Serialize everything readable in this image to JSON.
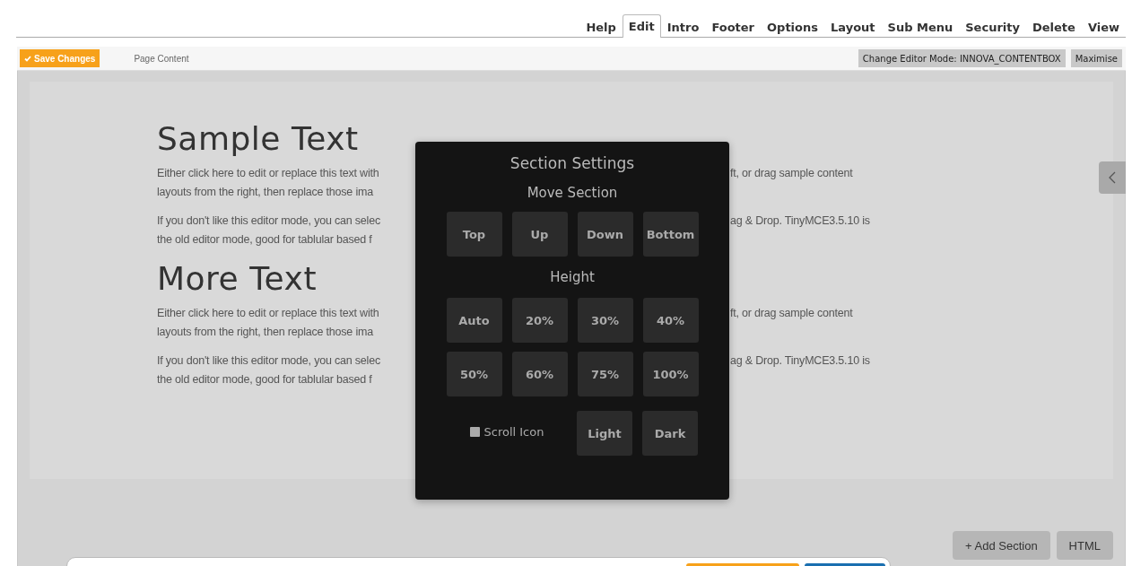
{
  "tabs": [
    {
      "label": "Help",
      "selected": false
    },
    {
      "label": "Edit",
      "selected": true
    },
    {
      "label": "Intro",
      "selected": false
    },
    {
      "label": "Footer",
      "selected": false
    },
    {
      "label": "Options",
      "selected": false
    },
    {
      "label": "Layout",
      "selected": false
    },
    {
      "label": "Sub Menu",
      "selected": false
    },
    {
      "label": "Security",
      "selected": false
    },
    {
      "label": "Delete",
      "selected": false
    },
    {
      "label": "View",
      "selected": false
    }
  ],
  "toolbar": {
    "save_button": "Save Changes",
    "title": "Page Content",
    "mode_button": "Change Editor Mode: INNOVA_CONTENTBOX",
    "maximise_button": "Maximise"
  },
  "content": [
    {
      "kind": "heading",
      "text": "Sample Text"
    },
    {
      "kind": "paragraph",
      "lines": [
        {
          "left": "Either click here to edit or replace this text with",
          "right": "ft, or drag sample content"
        },
        {
          "left": "layouts from the right, then replace those ima"
        }
      ]
    },
    {
      "kind": "paragraph",
      "lines": [
        {
          "left": "If you don't like this editor mode, you can selec",
          "right": "ag & Drop. TinyMCE3.5.10 is"
        },
        {
          "left": "the old editor mode, good for tablular based f"
        }
      ]
    },
    {
      "kind": "heading",
      "text": "More Text"
    },
    {
      "kind": "paragraph",
      "lines": [
        {
          "left": "Either click here to edit or replace this text with",
          "right": "ft, or drag sample content"
        },
        {
          "left": "layouts from the right, then replace those ima"
        }
      ]
    },
    {
      "kind": "paragraph",
      "lines": [
        {
          "left": "If you don't like this editor mode, you can selec",
          "right": "ag & Drop. TinyMCE3.5.10 is"
        },
        {
          "left": "the old editor mode, good for tablular based f"
        }
      ]
    }
  ],
  "section_settings": {
    "title": "Section Settings",
    "move_heading": "Move Section",
    "move_buttons": [
      "Top",
      "Up",
      "Down",
      "Bottom"
    ],
    "height_heading": "Height",
    "height_buttons": [
      "Auto",
      "20%",
      "30%",
      "40%",
      "50%",
      "60%",
      "75%",
      "100%"
    ],
    "scroll_icon": {
      "label": "Scroll Icon",
      "checked": false
    },
    "theme_buttons": [
      "Light",
      "Dark"
    ]
  },
  "bottom_buttons": [
    "+ Add Section",
    "HTML"
  ]
}
